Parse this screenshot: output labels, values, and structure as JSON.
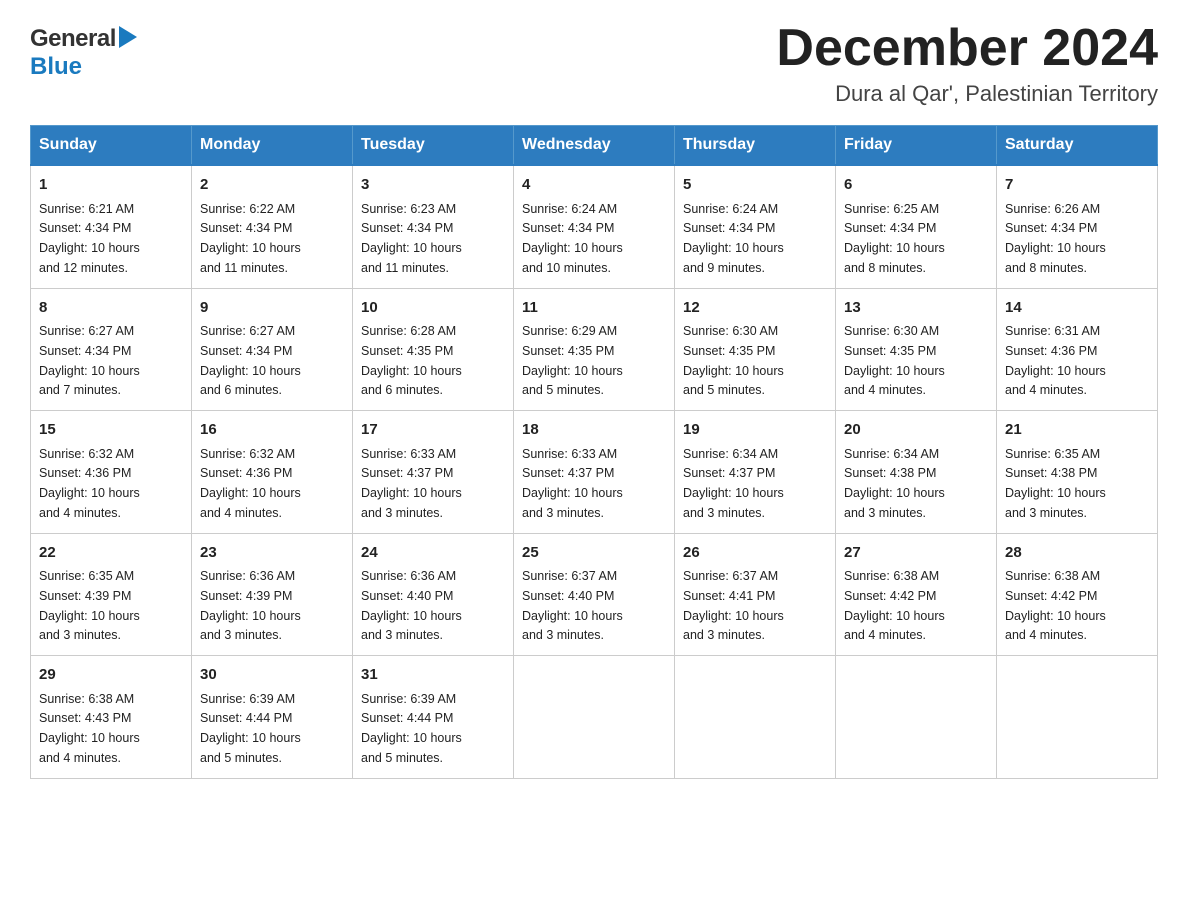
{
  "header": {
    "logo_general": "General",
    "logo_blue": "Blue",
    "month_title": "December 2024",
    "location": "Dura al Qar', Palestinian Territory"
  },
  "calendar": {
    "days": [
      "Sunday",
      "Monday",
      "Tuesday",
      "Wednesday",
      "Thursday",
      "Friday",
      "Saturday"
    ],
    "weeks": [
      [
        {
          "day": "1",
          "info": "Sunrise: 6:21 AM\nSunset: 4:34 PM\nDaylight: 10 hours\nand 12 minutes."
        },
        {
          "day": "2",
          "info": "Sunrise: 6:22 AM\nSunset: 4:34 PM\nDaylight: 10 hours\nand 11 minutes."
        },
        {
          "day": "3",
          "info": "Sunrise: 6:23 AM\nSunset: 4:34 PM\nDaylight: 10 hours\nand 11 minutes."
        },
        {
          "day": "4",
          "info": "Sunrise: 6:24 AM\nSunset: 4:34 PM\nDaylight: 10 hours\nand 10 minutes."
        },
        {
          "day": "5",
          "info": "Sunrise: 6:24 AM\nSunset: 4:34 PM\nDaylight: 10 hours\nand 9 minutes."
        },
        {
          "day": "6",
          "info": "Sunrise: 6:25 AM\nSunset: 4:34 PM\nDaylight: 10 hours\nand 8 minutes."
        },
        {
          "day": "7",
          "info": "Sunrise: 6:26 AM\nSunset: 4:34 PM\nDaylight: 10 hours\nand 8 minutes."
        }
      ],
      [
        {
          "day": "8",
          "info": "Sunrise: 6:27 AM\nSunset: 4:34 PM\nDaylight: 10 hours\nand 7 minutes."
        },
        {
          "day": "9",
          "info": "Sunrise: 6:27 AM\nSunset: 4:34 PM\nDaylight: 10 hours\nand 6 minutes."
        },
        {
          "day": "10",
          "info": "Sunrise: 6:28 AM\nSunset: 4:35 PM\nDaylight: 10 hours\nand 6 minutes."
        },
        {
          "day": "11",
          "info": "Sunrise: 6:29 AM\nSunset: 4:35 PM\nDaylight: 10 hours\nand 5 minutes."
        },
        {
          "day": "12",
          "info": "Sunrise: 6:30 AM\nSunset: 4:35 PM\nDaylight: 10 hours\nand 5 minutes."
        },
        {
          "day": "13",
          "info": "Sunrise: 6:30 AM\nSunset: 4:35 PM\nDaylight: 10 hours\nand 4 minutes."
        },
        {
          "day": "14",
          "info": "Sunrise: 6:31 AM\nSunset: 4:36 PM\nDaylight: 10 hours\nand 4 minutes."
        }
      ],
      [
        {
          "day": "15",
          "info": "Sunrise: 6:32 AM\nSunset: 4:36 PM\nDaylight: 10 hours\nand 4 minutes."
        },
        {
          "day": "16",
          "info": "Sunrise: 6:32 AM\nSunset: 4:36 PM\nDaylight: 10 hours\nand 4 minutes."
        },
        {
          "day": "17",
          "info": "Sunrise: 6:33 AM\nSunset: 4:37 PM\nDaylight: 10 hours\nand 3 minutes."
        },
        {
          "day": "18",
          "info": "Sunrise: 6:33 AM\nSunset: 4:37 PM\nDaylight: 10 hours\nand 3 minutes."
        },
        {
          "day": "19",
          "info": "Sunrise: 6:34 AM\nSunset: 4:37 PM\nDaylight: 10 hours\nand 3 minutes."
        },
        {
          "day": "20",
          "info": "Sunrise: 6:34 AM\nSunset: 4:38 PM\nDaylight: 10 hours\nand 3 minutes."
        },
        {
          "day": "21",
          "info": "Sunrise: 6:35 AM\nSunset: 4:38 PM\nDaylight: 10 hours\nand 3 minutes."
        }
      ],
      [
        {
          "day": "22",
          "info": "Sunrise: 6:35 AM\nSunset: 4:39 PM\nDaylight: 10 hours\nand 3 minutes."
        },
        {
          "day": "23",
          "info": "Sunrise: 6:36 AM\nSunset: 4:39 PM\nDaylight: 10 hours\nand 3 minutes."
        },
        {
          "day": "24",
          "info": "Sunrise: 6:36 AM\nSunset: 4:40 PM\nDaylight: 10 hours\nand 3 minutes."
        },
        {
          "day": "25",
          "info": "Sunrise: 6:37 AM\nSunset: 4:40 PM\nDaylight: 10 hours\nand 3 minutes."
        },
        {
          "day": "26",
          "info": "Sunrise: 6:37 AM\nSunset: 4:41 PM\nDaylight: 10 hours\nand 3 minutes."
        },
        {
          "day": "27",
          "info": "Sunrise: 6:38 AM\nSunset: 4:42 PM\nDaylight: 10 hours\nand 4 minutes."
        },
        {
          "day": "28",
          "info": "Sunrise: 6:38 AM\nSunset: 4:42 PM\nDaylight: 10 hours\nand 4 minutes."
        }
      ],
      [
        {
          "day": "29",
          "info": "Sunrise: 6:38 AM\nSunset: 4:43 PM\nDaylight: 10 hours\nand 4 minutes."
        },
        {
          "day": "30",
          "info": "Sunrise: 6:39 AM\nSunset: 4:44 PM\nDaylight: 10 hours\nand 5 minutes."
        },
        {
          "day": "31",
          "info": "Sunrise: 6:39 AM\nSunset: 4:44 PM\nDaylight: 10 hours\nand 5 minutes."
        },
        null,
        null,
        null,
        null
      ]
    ]
  }
}
